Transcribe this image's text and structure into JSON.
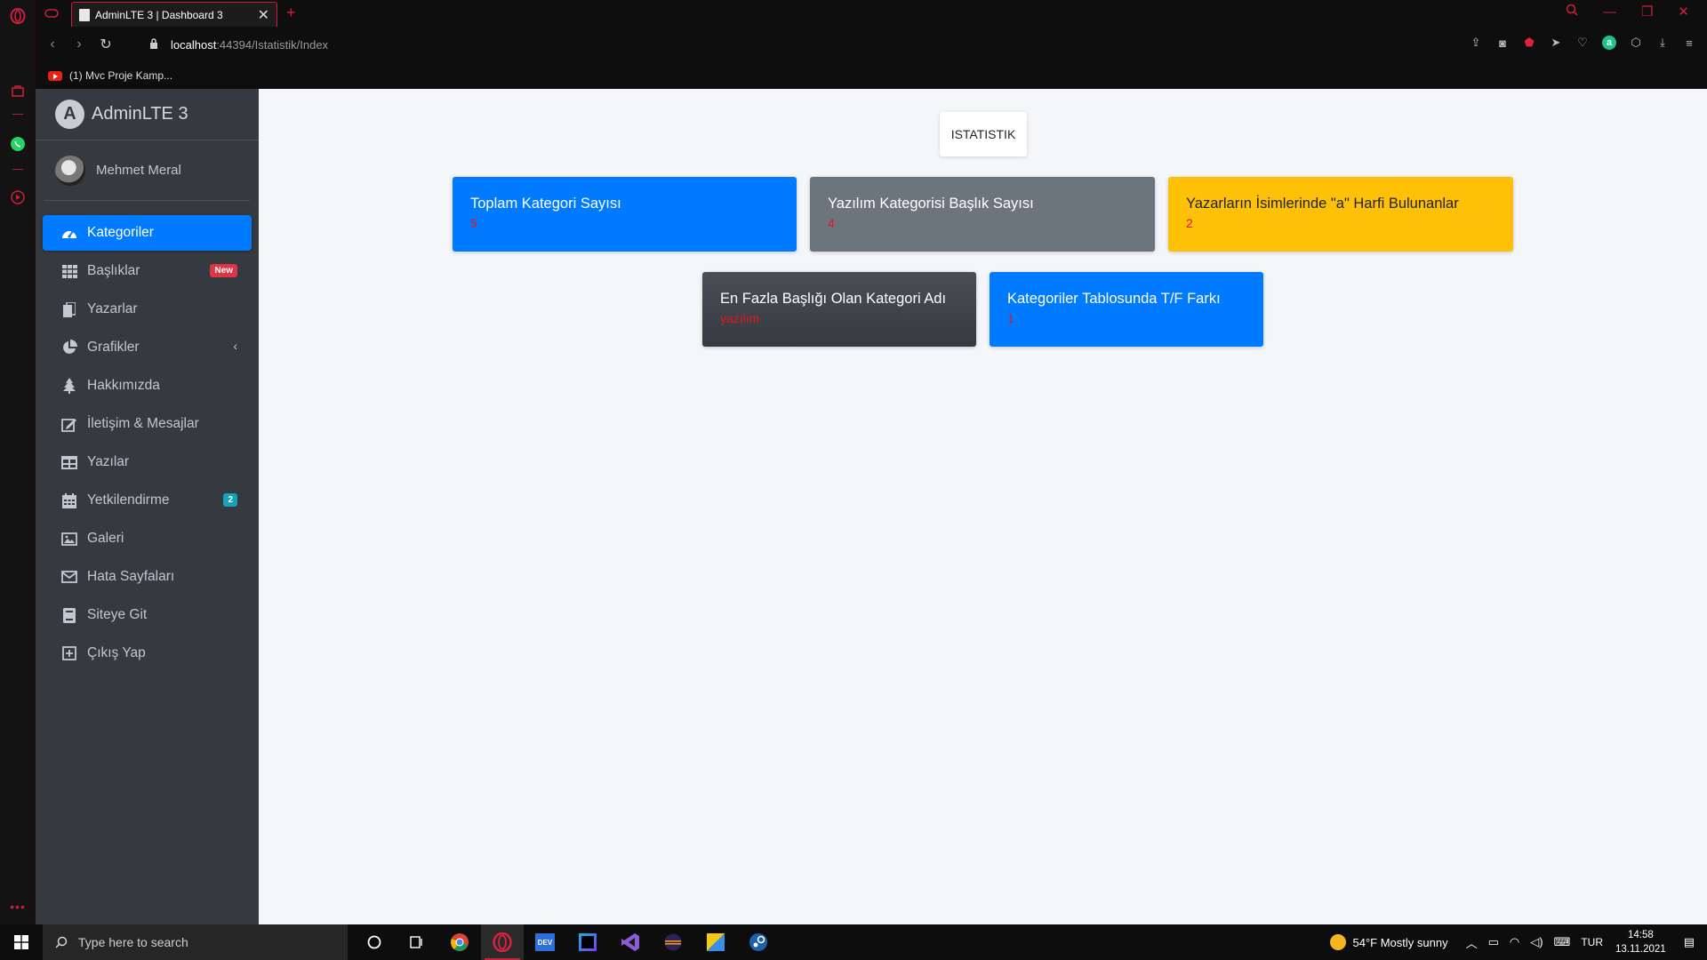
{
  "browser": {
    "tab_title": "AdminLTE 3 | Dashboard 3",
    "url_host": "localhost",
    "url_path": ":44394/Istatistik/Index",
    "bookmark": "(1) Mvc Proje Kamp..."
  },
  "sidebar": {
    "brand": "AdminLTE 3",
    "user_name": "Mehmet Meral",
    "items": [
      {
        "label": "Kategoriler",
        "icon": "dashboard-icon"
      },
      {
        "label": "Başlıklar",
        "icon": "grid-icon",
        "badge": "New"
      },
      {
        "label": "Yazarlar",
        "icon": "copy-icon"
      },
      {
        "label": "Grafikler",
        "icon": "pie-chart-icon"
      },
      {
        "label": "Hakkımızda",
        "icon": "tree-icon"
      },
      {
        "label": "İletişim & Mesajlar",
        "icon": "edit-icon"
      },
      {
        "label": "Yazılar",
        "icon": "table-icon"
      },
      {
        "label": "Yetkilendirme",
        "icon": "calendar-icon",
        "badge": "2"
      },
      {
        "label": "Galeri",
        "icon": "image-icon"
      },
      {
        "label": "Hata Sayfaları",
        "icon": "envelope-icon"
      },
      {
        "label": "Siteye Git",
        "icon": "book-icon"
      },
      {
        "label": "Çıkış Yap",
        "icon": "plus-square-icon"
      }
    ]
  },
  "main": {
    "heading": "ISTATISTIK",
    "boxes": [
      {
        "title": "Toplam Kategori Sayısı",
        "value": "5"
      },
      {
        "title": "Yazılım Kategorisi Başlık Sayısı",
        "value": "4"
      },
      {
        "title": "Yazarların İsimlerinde \"a\" Harfi Bulunanlar",
        "value": "2"
      },
      {
        "title": "En Fazla Başlığı Olan Kategori Adı",
        "value": "yazılım"
      },
      {
        "title": "Kategoriler Tablosunda T/F Farkı",
        "value": "1"
      }
    ]
  },
  "taskbar": {
    "search_placeholder": "Type here to search",
    "weather": "54°F  Mostly sunny",
    "lang": "TUR",
    "time": "14:58",
    "date": "13.11.2021"
  }
}
